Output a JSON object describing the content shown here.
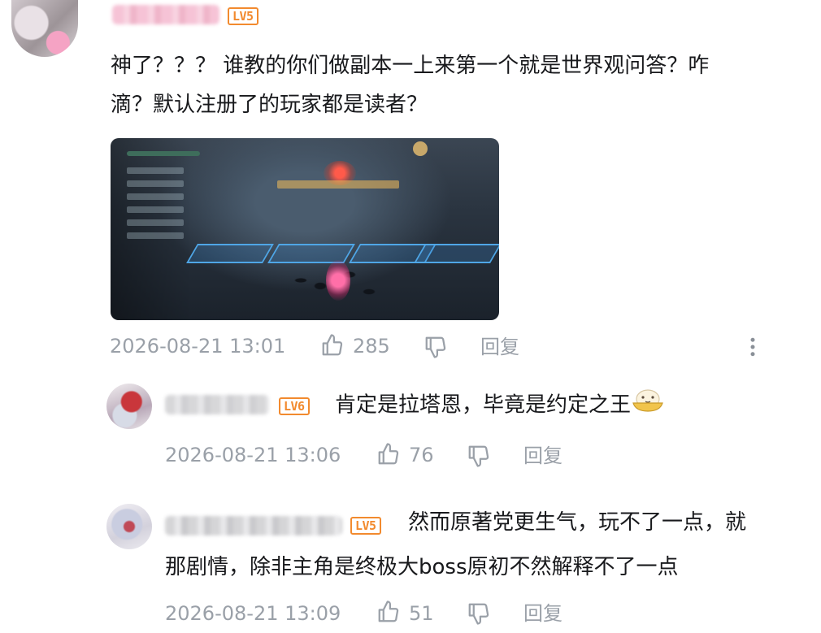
{
  "comments": [
    {
      "level_badge": "LV5",
      "text_lines": [
        "神了？？？ 谁教的你们做副本一上来第一个就是世界观问答？咋",
        "滴？默认注册了的玩家都是读者？"
      ],
      "timestamp": "2026-08-21 13:01",
      "like_count": "285",
      "reply_label": "回复",
      "has_image": true
    },
    {
      "level_badge": "LV6",
      "text_lines": [
        "肯定是拉塔恩，毕竟是约定之王"
      ],
      "trailing_emoji": "noodle-bowl-emoji",
      "timestamp": "2026-08-21 13:06",
      "like_count": "76",
      "reply_label": "回复"
    },
    {
      "level_badge": "LV5",
      "text_lines": [
        "然而原著党更生气，玩不了一点，就",
        "那剧情，除非主角是终极大boss原初不然解释不了一点"
      ],
      "timestamp": "2026-08-21 13:09",
      "like_count": "51",
      "reply_label": "回复"
    }
  ],
  "icons": {
    "like": "thumbs-up-icon",
    "dislike": "thumbs-down-icon",
    "more": "more-vertical-icon"
  },
  "colors": {
    "text": "#18191c",
    "meta": "#9aa0a8",
    "level_badge": "#f28a2e"
  }
}
